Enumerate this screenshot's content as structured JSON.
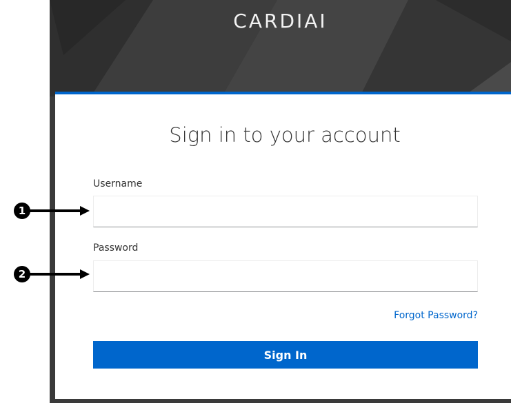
{
  "header": {
    "brand": "CARDIAI"
  },
  "login": {
    "title": "Sign in to your account",
    "username_label": "Username",
    "username_value": "",
    "password_label": "Password",
    "password_value": "",
    "forgot_password": "Forgot Password?",
    "sign_in_label": "Sign In"
  },
  "callouts": [
    {
      "number": "1",
      "target": "username-input"
    },
    {
      "number": "2",
      "target": "password-input"
    }
  ],
  "colors": {
    "accent": "#0066cc",
    "header_bg": "#3a3a3a",
    "title_text": "#333333"
  }
}
